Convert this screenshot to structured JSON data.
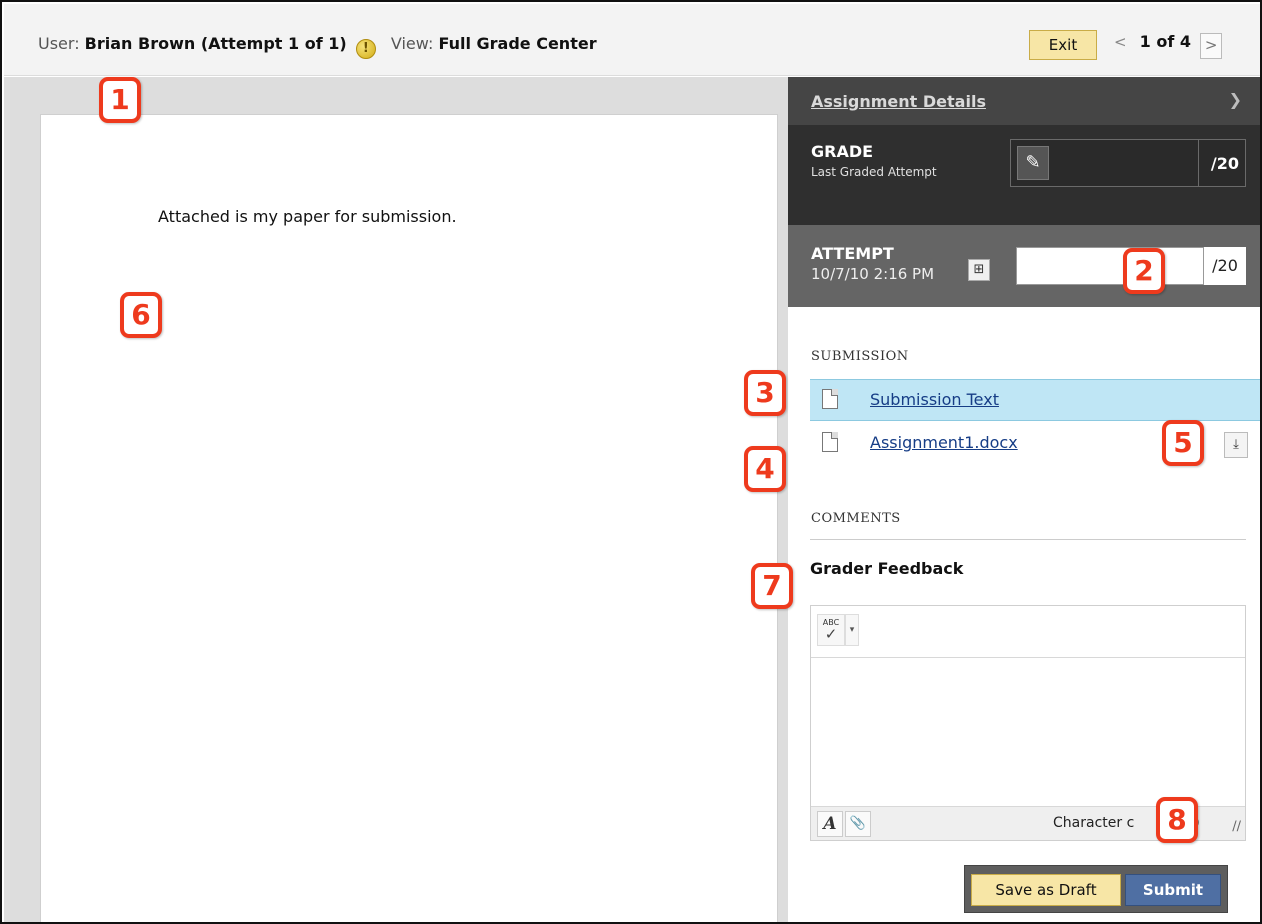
{
  "topbar": {
    "user_label": "User:",
    "user_name": "Brian Brown (Attempt 1 of 1)",
    "view_label": "View:",
    "view_name": "Full Grade Center",
    "exit_label": "Exit",
    "prev_symbol": "<",
    "pager_text": "1 of 4",
    "next_symbol": ">"
  },
  "paper": {
    "text": "Attached is my paper for submission."
  },
  "panel": {
    "details_title": "Assignment Details",
    "grade": {
      "label": "GRADE",
      "sublabel": "Last Graded Attempt",
      "max": "/20"
    },
    "attempt": {
      "label": "ATTEMPT",
      "date": "10/7/10 2:16 PM",
      "value": "",
      "max": "/20"
    },
    "submission_label": "SUBMISSION",
    "files": [
      {
        "name": "Submission Text",
        "selected": true
      },
      {
        "name": "Assignment1.docx",
        "selected": false
      }
    ],
    "comments_label": "COMMENTS",
    "feedback_label": "Grader Feedback",
    "editor": {
      "spell_text": "ABC",
      "char_count_text": "Character c",
      "char_count_tail": ")"
    },
    "actions": {
      "draft_label": "Save as Draft",
      "submit_label": "Submit"
    }
  },
  "callouts": [
    "1",
    "2",
    "3",
    "4",
    "5",
    "6",
    "7",
    "8"
  ],
  "colors": {
    "callout": "#ee3a1d",
    "selected_row": "#bfe6f5",
    "draft_button": "#f7e6a6",
    "submit_button": "#4f6fa3",
    "grade_header": "#2f2f2f"
  },
  "icons": [
    "warning-icon",
    "pencil-icon",
    "note-icon",
    "document-icon",
    "download-icon",
    "spellcheck-icon",
    "dropdown-icon",
    "font-format-icon",
    "attach-icon",
    "chevron-down-icon",
    "resize-handle-icon"
  ]
}
